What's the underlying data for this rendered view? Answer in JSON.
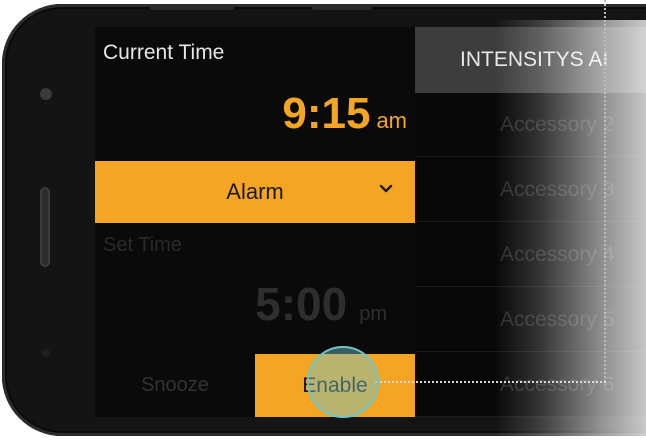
{
  "current_time": {
    "label": "Current Time",
    "value": "9:15",
    "period": "am"
  },
  "mode_select": {
    "selected": "Alarm"
  },
  "set_time": {
    "label": "Set Time",
    "value": "5:00",
    "period": "pm"
  },
  "actions": {
    "snooze_label": "Snooze",
    "enable_label": "Enable"
  },
  "right_panel": {
    "header": "INTENSITYS AI",
    "items": [
      {
        "label": "Accessory 2"
      },
      {
        "label": "Accessory 3"
      },
      {
        "label": "Accessory 4"
      },
      {
        "label": "Accessory 5"
      },
      {
        "label": "Accessory 6"
      }
    ]
  },
  "colors": {
    "accent": "#f5a524",
    "tap_indicator": "#6fc5c9"
  }
}
